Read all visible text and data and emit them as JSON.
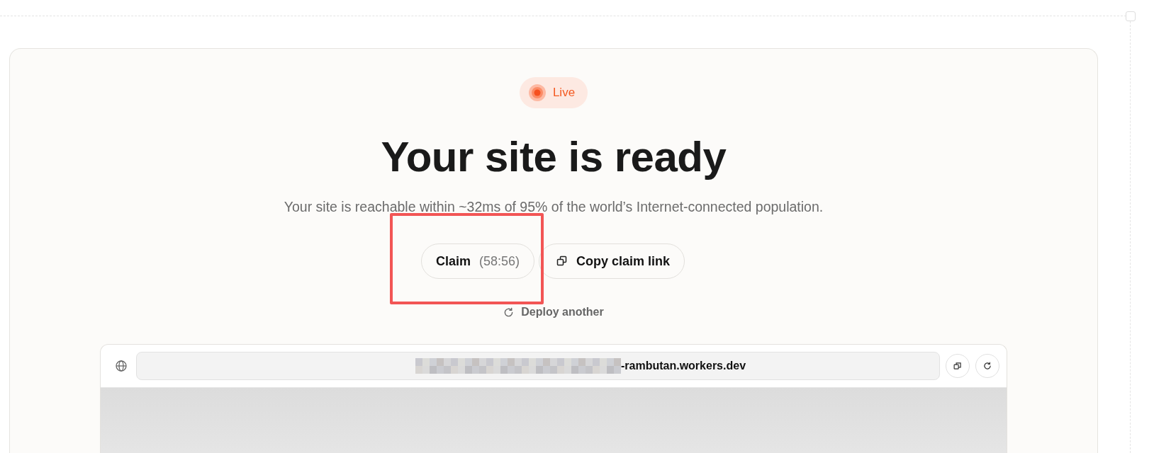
{
  "status_badge": {
    "label": "Live",
    "live": true
  },
  "heading": "Your site is ready",
  "subtitle": "Your site is reachable within ~32ms of 95% of the world’s Internet-connected population.",
  "claim_button": {
    "label": "Claim",
    "countdown": "(58:56)",
    "highlighted": true
  },
  "copy_button": {
    "label": "Copy claim link"
  },
  "deploy_link": {
    "label": "Deploy another"
  },
  "preview": {
    "url_redacted": true,
    "url": "-rambutan.workers.dev"
  }
}
